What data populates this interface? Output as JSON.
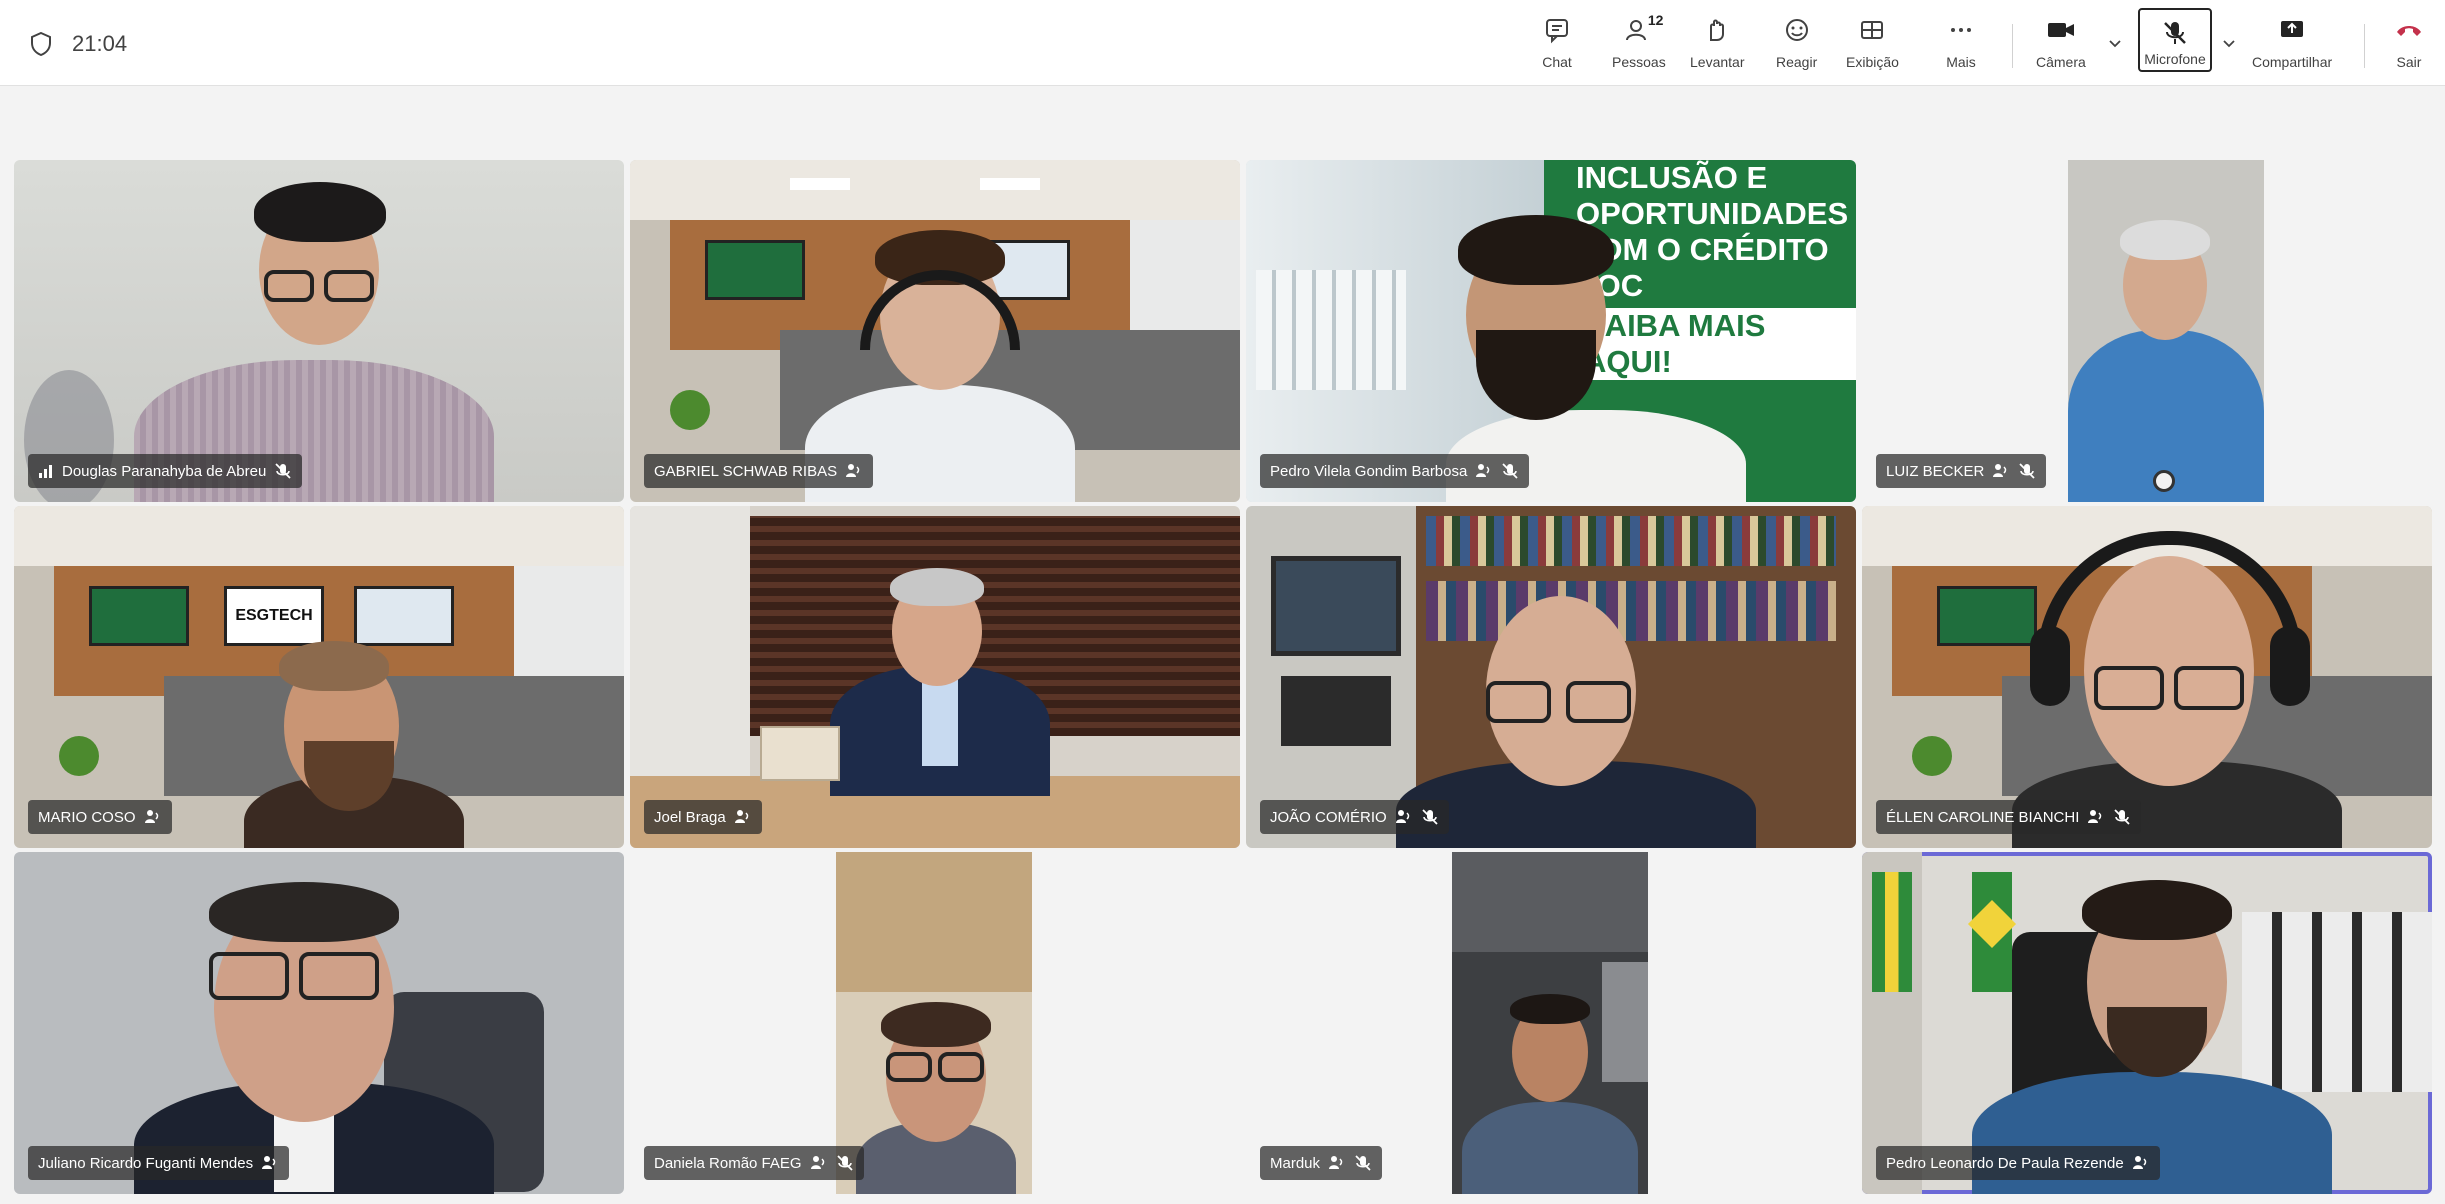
{
  "topbar": {
    "time": "21:04",
    "people_count": "12",
    "buttons": {
      "chat": "Chat",
      "people": "Pessoas",
      "raise": "Levantar",
      "react": "Reagir",
      "view": "Exibição",
      "more": "Mais",
      "camera": "Câmera",
      "mic": "Microfone",
      "share": "Compartilhar",
      "leave": "Sair"
    },
    "leave_color": "#c4314b"
  },
  "participants": [
    {
      "name": "Douglas Paranahyba de Abreu",
      "muted": true,
      "signal_icon": true
    },
    {
      "name": "GABRIEL SCHWAB RIBAS",
      "muted": false
    },
    {
      "name": "Pedro Vilela Gondim Barbosa",
      "muted": true
    },
    {
      "name": "LUIZ BECKER",
      "muted": true
    },
    {
      "name": "MARIO COSO",
      "muted": false
    },
    {
      "name": "Joel Braga",
      "muted": false
    },
    {
      "name": "JOÃO COMÉRIO",
      "muted": true
    },
    {
      "name": "ÉLLEN CAROLINE BIANCHI",
      "muted": true
    },
    {
      "name": "Juliano Ricardo Fuganti Mendes",
      "muted": false
    },
    {
      "name": "Daniela Romão FAEG",
      "muted": true
    },
    {
      "name": "Marduk",
      "muted": true
    },
    {
      "name": "Pedro Leonardo De Paula Rezende",
      "muted": false,
      "selected": true
    }
  ],
  "backgrounds": {
    "banner_lines": [
      "INCLUSÃO E",
      "OPORTUNIDADES",
      "COM O CRÉDITO SOC",
      "SAIBA MAIS AQUI!"
    ],
    "esg_logo": "ESGTECH"
  },
  "colors": {
    "accent": "#6b69d6",
    "banner_green": "#1f7a3f"
  }
}
